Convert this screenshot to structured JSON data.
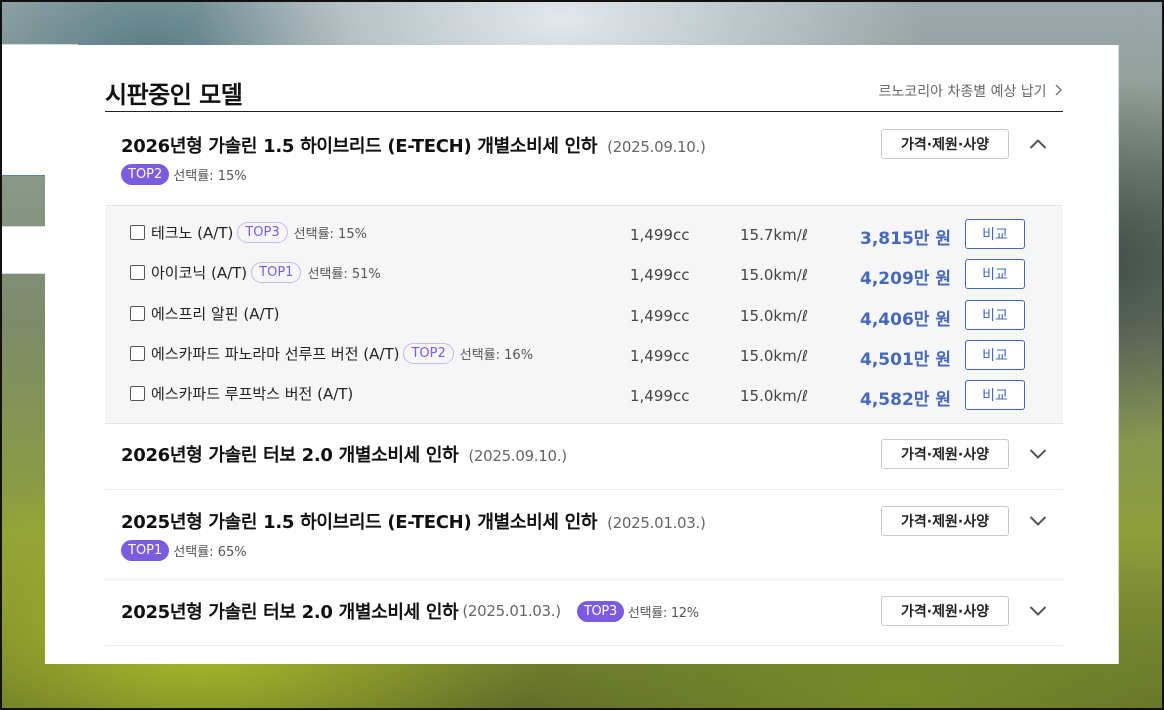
{
  "section": {
    "title": "시판중인 모델",
    "link_label": "르노코리아 차종별 예상 납기"
  },
  "groups": [
    {
      "title": "2026년형 가솔린 1.5 하이브리드 (E-TECH) 개별소비세 인하",
      "date": "(2025.09.10.)",
      "badge": "TOP2",
      "rate": "선택률: 15%",
      "spec_label": "가격·제원·사양",
      "expanded": true,
      "trims": [
        {
          "name": "테크노 (A/T)",
          "badge": "TOP3",
          "rate": "선택률: 15%",
          "cc": "1,499cc",
          "efficiency": "15.7km/ℓ",
          "price": "3,815만 원",
          "compare_label": "비교"
        },
        {
          "name": "아이코닉 (A/T)",
          "badge": "TOP1",
          "rate": "선택률: 51%",
          "cc": "1,499cc",
          "efficiency": "15.0km/ℓ",
          "price": "4,209만 원",
          "compare_label": "비교"
        },
        {
          "name": "에스프리 알핀 (A/T)",
          "badge": "",
          "rate": "",
          "cc": "1,499cc",
          "efficiency": "15.0km/ℓ",
          "price": "4,406만 원",
          "compare_label": "비교"
        },
        {
          "name": "에스카파드 파노라마 선루프 버전 (A/T)",
          "badge": "TOP2",
          "rate": "선택률: 16%",
          "cc": "1,499cc",
          "efficiency": "15.0km/ℓ",
          "price": "4,501만 원",
          "compare_label": "비교"
        },
        {
          "name": "에스카파드 루프박스 버전 (A/T)",
          "badge": "",
          "rate": "",
          "cc": "1,499cc",
          "efficiency": "15.0km/ℓ",
          "price": "4,582만 원",
          "compare_label": "비교"
        }
      ]
    },
    {
      "title": "2026년형 가솔린 터보 2.0 개별소비세 인하",
      "date": "(2025.09.10.)",
      "spec_label": "가격·제원·사양",
      "expanded": false
    },
    {
      "title": "2025년형 가솔린 1.5 하이브리드 (E-TECH) 개별소비세 인하",
      "date": "(2025.01.03.)",
      "badge": "TOP1",
      "rate": "선택률: 65%",
      "spec_label": "가격·제원·사양",
      "expanded": false
    },
    {
      "title": "2025년형 가솔린 터보 2.0 개별소비세 인하",
      "date": "(2025.01.03.)",
      "badge": "TOP3",
      "rate": "선택률: 12%",
      "spec_label": "가격·제원·사양",
      "expanded": false
    }
  ],
  "icons": {
    "expand": "chevron-down-icon",
    "collapse": "chevron-up-icon",
    "link": "chevron-right-icon"
  },
  "colors": {
    "badge": "#7b5ce0",
    "price": "#4668b8"
  }
}
